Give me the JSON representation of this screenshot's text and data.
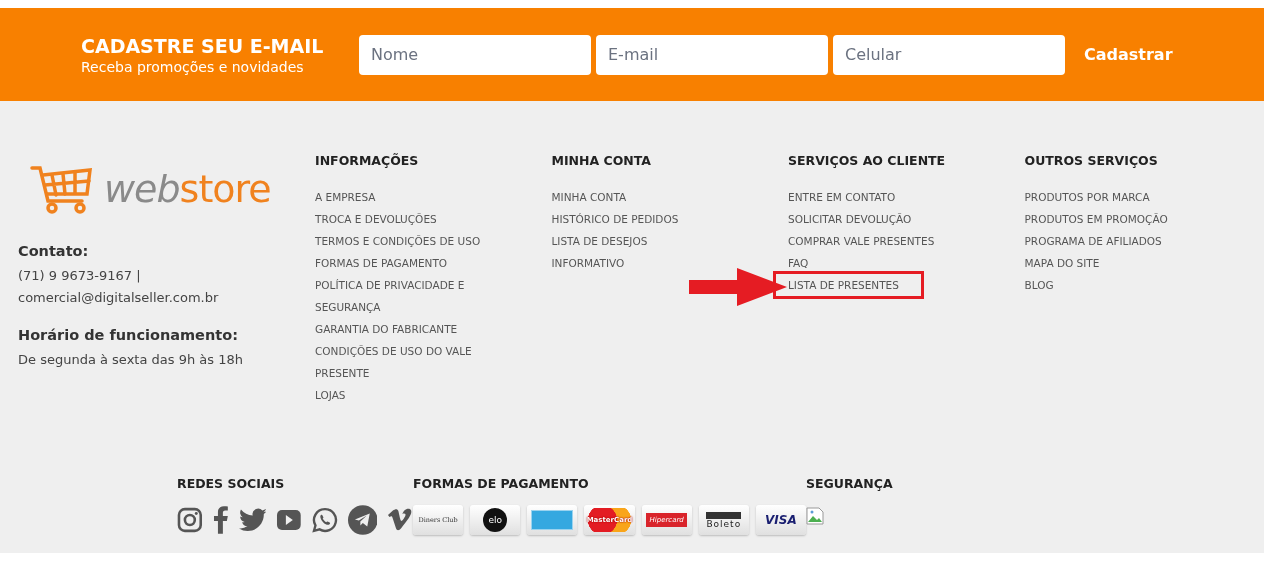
{
  "newsletter": {
    "title": "CADASTRE SEU E-MAIL",
    "subtitle": "Receba promoções e novidades",
    "fields": [
      {
        "placeholder": "Nome"
      },
      {
        "placeholder": "E-mail"
      },
      {
        "placeholder": "Celular"
      }
    ],
    "button": "Cadastrar"
  },
  "logo": {
    "part1": "web",
    "part2": "store"
  },
  "contact": {
    "heading": "Contato:",
    "lines": [
      "(71) 9 9673-9167 |",
      "comercial@digitalseller.com.br"
    ],
    "hours_heading": "Horário de funcionamento:",
    "hours": "De segunda à sexta das 9h às 18h"
  },
  "columns": [
    {
      "heading": "INFORMAÇÕES",
      "links": [
        {
          "label": "A EMPRESA",
          "highlighted": false
        },
        {
          "label": "TROCA E DEVOLUÇÕES",
          "highlighted": false
        },
        {
          "label": "TERMOS E CONDIÇÕES DE USO",
          "highlighted": false
        },
        {
          "label": "FORMAS DE PAGAMENTO",
          "highlighted": false
        },
        {
          "label": "POLÍTICA DE PRIVACIDADE E SEGURANÇA",
          "highlighted": false
        },
        {
          "label": "GARANTIA DO FABRICANTE",
          "highlighted": false
        },
        {
          "label": "CONDIÇÕES DE USO DO VALE PRESENTE",
          "highlighted": false
        },
        {
          "label": "LOJAS",
          "highlighted": false
        }
      ]
    },
    {
      "heading": "MINHA CONTA",
      "links": [
        {
          "label": "MINHA CONTA",
          "highlighted": false
        },
        {
          "label": "HISTÓRICO DE PEDIDOS",
          "highlighted": false
        },
        {
          "label": "LISTA DE DESEJOS",
          "highlighted": false
        },
        {
          "label": "INFORMATIVO",
          "highlighted": false
        }
      ]
    },
    {
      "heading": "SERVIÇOS AO CLIENTE",
      "links": [
        {
          "label": "ENTRE EM CONTATO",
          "highlighted": false
        },
        {
          "label": "SOLICITAR DEVOLUÇÃO",
          "highlighted": false
        },
        {
          "label": "COMPRAR VALE PRESENTES",
          "highlighted": false
        },
        {
          "label": "FAQ",
          "highlighted": false
        },
        {
          "label": "LISTA DE PRESENTES",
          "highlighted": true
        }
      ]
    },
    {
      "heading": "OUTROS SERVIÇOS",
      "links": [
        {
          "label": "PRODUTOS POR MARCA",
          "highlighted": false
        },
        {
          "label": "PRODUTOS EM PROMOÇÃO",
          "highlighted": false
        },
        {
          "label": "PROGRAMA DE AFILIADOS",
          "highlighted": false
        },
        {
          "label": "MAPA DO SITE",
          "highlighted": false
        },
        {
          "label": "BLOG",
          "highlighted": false
        }
      ]
    }
  ],
  "social": {
    "heading": "REDES SOCIAIS",
    "icons": [
      {
        "kind": "instagram"
      },
      {
        "kind": "facebook"
      },
      {
        "kind": "twitter"
      },
      {
        "kind": "youtube"
      },
      {
        "kind": "whatsapp"
      },
      {
        "kind": "telegram"
      },
      {
        "kind": "vimeo"
      }
    ]
  },
  "payment": {
    "heading": "FORMAS DE PAGAMENTO",
    "cards": [
      {
        "kind": "diners",
        "label": "Diners Club"
      },
      {
        "kind": "elo",
        "label": "elo"
      },
      {
        "kind": "amex"
      },
      {
        "kind": "mastercard",
        "label": "MasterCard"
      },
      {
        "kind": "hipercard",
        "label": "Hipercard"
      },
      {
        "kind": "boleto",
        "label": "Boleto"
      },
      {
        "kind": "visa",
        "label": "VISA"
      }
    ]
  },
  "security": {
    "heading": "SEGURANÇA"
  }
}
